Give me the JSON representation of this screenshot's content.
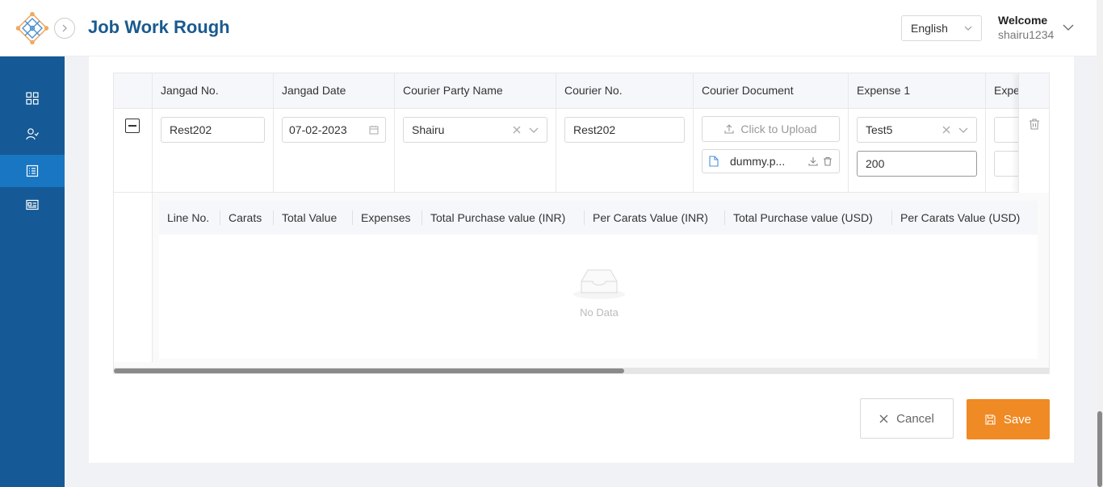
{
  "header": {
    "app_title": "Job Work Rough",
    "language": "English",
    "welcome_label": "Welcome",
    "username": "shairu1234"
  },
  "sidebar": {
    "items": [
      {
        "icon": "dashboard-icon",
        "active": false
      },
      {
        "icon": "users-icon",
        "active": false
      },
      {
        "icon": "list-icon",
        "active": true
      },
      {
        "icon": "id-card-icon",
        "active": false
      }
    ]
  },
  "table": {
    "columns": [
      "Jangad No.",
      "Jangad Date",
      "Courier Party Name",
      "Courier No.",
      "Courier Document",
      "Expense 1",
      "Expe"
    ],
    "row": {
      "jangad_no": "Rest202",
      "jangad_date": "07-02-2023",
      "courier_party_name": "Shairu",
      "courier_no": "Rest202",
      "upload_label": "Click to Upload",
      "file_name": "dummy.p...",
      "expense1_name": "Test5",
      "expense1_amount": "200"
    }
  },
  "subtable": {
    "columns": [
      "Line No.",
      "Carats",
      "Total Value",
      "Expenses",
      "Total Purchase value (INR)",
      "Per Carats Value (INR)",
      "Total Purchase value (USD)",
      "Per Carats Value (USD)"
    ],
    "empty_text": "No Data"
  },
  "actions": {
    "cancel_label": "Cancel",
    "save_label": "Save"
  },
  "colors": {
    "sidebar": "#155a96",
    "sidebar_active": "#1976c2",
    "title": "#1a5a8f",
    "save": "#f08a24"
  }
}
